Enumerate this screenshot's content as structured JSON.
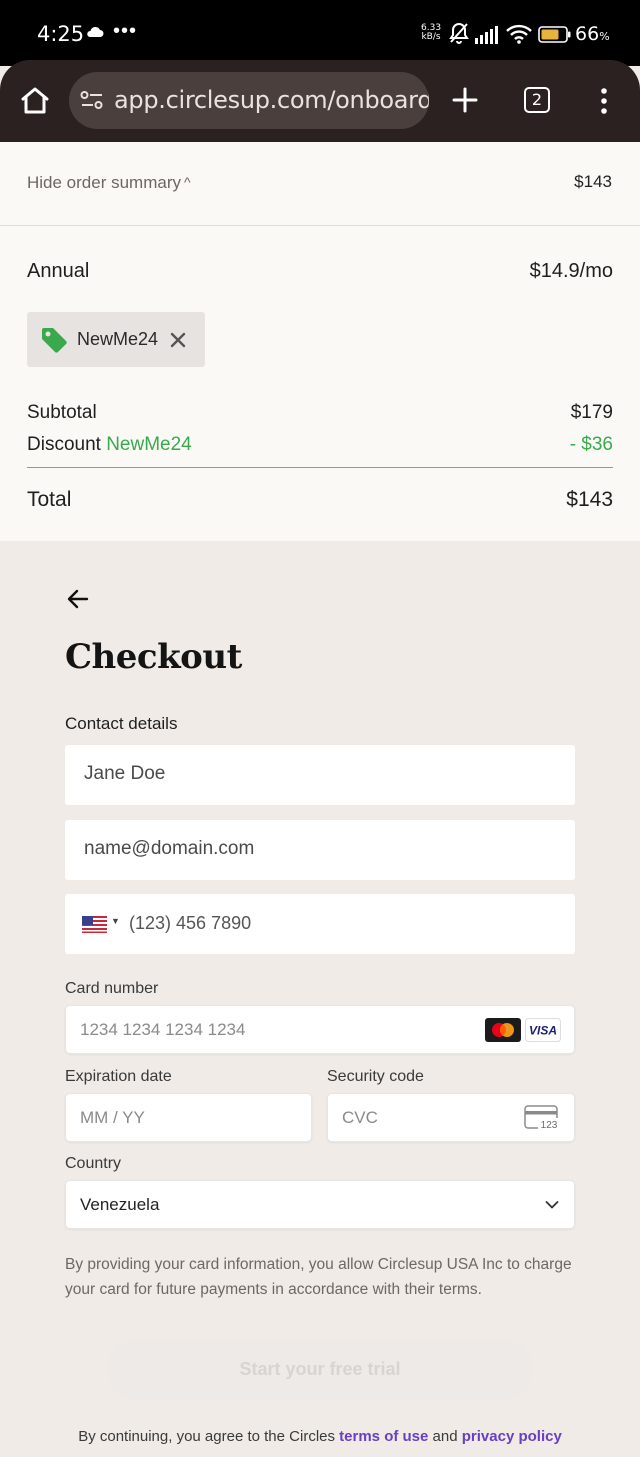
{
  "status_bar": {
    "time": "4:25",
    "net_speed_value": "6.33",
    "net_speed_unit": "kB/s",
    "battery": "66",
    "battery_unit": "%",
    "icons": [
      "cloud-icon",
      "more-dots-icon",
      "mute-bell-icon",
      "signal-icon",
      "wifi-icon",
      "battery-icon"
    ]
  },
  "browser": {
    "url": "app.circlesup.com/onboardin",
    "tab_count": "2",
    "icons": [
      "home-icon",
      "site-settings-icon",
      "new-tab-plus-icon",
      "tab-switcher-icon",
      "menu-kebab-icon"
    ]
  },
  "order_summary": {
    "toggle_label": "Hide order summary",
    "header_total": "$143",
    "plan_label": "Annual",
    "plan_price": "$14.9/mo",
    "promo_code": "NewMe24",
    "subtotal_label": "Subtotal",
    "subtotal_value": "$179",
    "discount_label": "Discount",
    "discount_code": "NewMe24",
    "discount_value": "- $36",
    "total_label": "Total",
    "total_value": "$143",
    "colors": {
      "discount": "#3aa84d",
      "tag": "#3aa84d"
    }
  },
  "checkout": {
    "title": "Checkout",
    "contact_label": "Contact details",
    "name_placeholder": "Jane Doe",
    "email_placeholder": "name@domain.com",
    "phone_country": "US",
    "phone_placeholder": "(123) 456 7890",
    "card_number_label": "Card number",
    "card_number_placeholder": "1234 1234 1234 1234",
    "card_brands": [
      "Mastercard",
      "VISA"
    ],
    "expiration_label": "Expiration date",
    "expiration_placeholder": "MM / YY",
    "security_label": "Security code",
    "security_placeholder": "CVC",
    "cvc_icon_text": "123",
    "country_label": "Country",
    "country_value": "Venezuela",
    "terms_text": "By providing your card information, you allow Circlesup USA Inc to charge your card for future payments in accordance with their terms.",
    "cta_label": "Start your free trial",
    "legal_prefix": "By continuing, you agree to the Circles",
    "legal_terms": "terms of use",
    "legal_and": "and",
    "legal_privacy": "privacy policy",
    "colors": {
      "link": "#6a3fc1",
      "cta_bg": "#eeeae8"
    }
  }
}
